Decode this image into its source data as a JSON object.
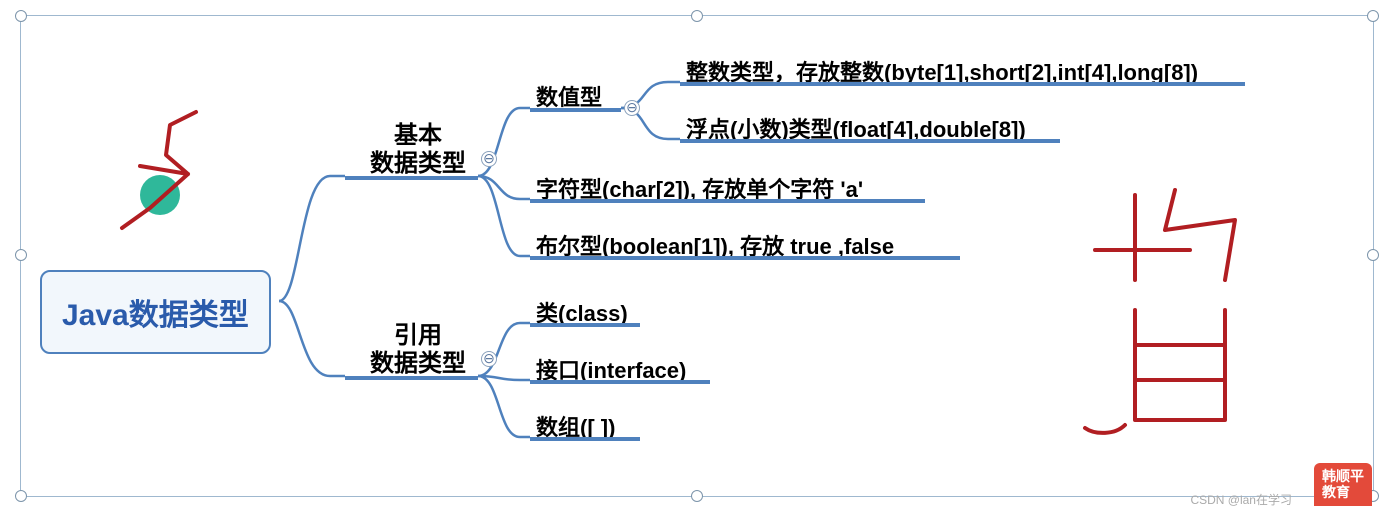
{
  "root": "Java数据类型",
  "lvl1": {
    "basic_l1": "基本",
    "basic_l2": "数据类型",
    "ref_l1": "引用",
    "ref_l2": "数据类型"
  },
  "lvl2": {
    "numeric": "数值型",
    "char": "字符型(char[2]), 存放单个字符  'a'",
    "bool": "布尔型(boolean[1]), 存放 true ,false",
    "class": "类(class)",
    "interface": "接口(interface)",
    "array": "数组([ ])"
  },
  "lvl3": {
    "int": "整数类型，存放整数(byte[1],short[2],int[4],long[8])",
    "float": "浮点(小数)类型(float[4],double[8])"
  },
  "collapse_glyph": "⊖",
  "logo_l1": "韩顺平",
  "logo_l2": "教育",
  "csdn": "CSDN @lan在学习"
}
